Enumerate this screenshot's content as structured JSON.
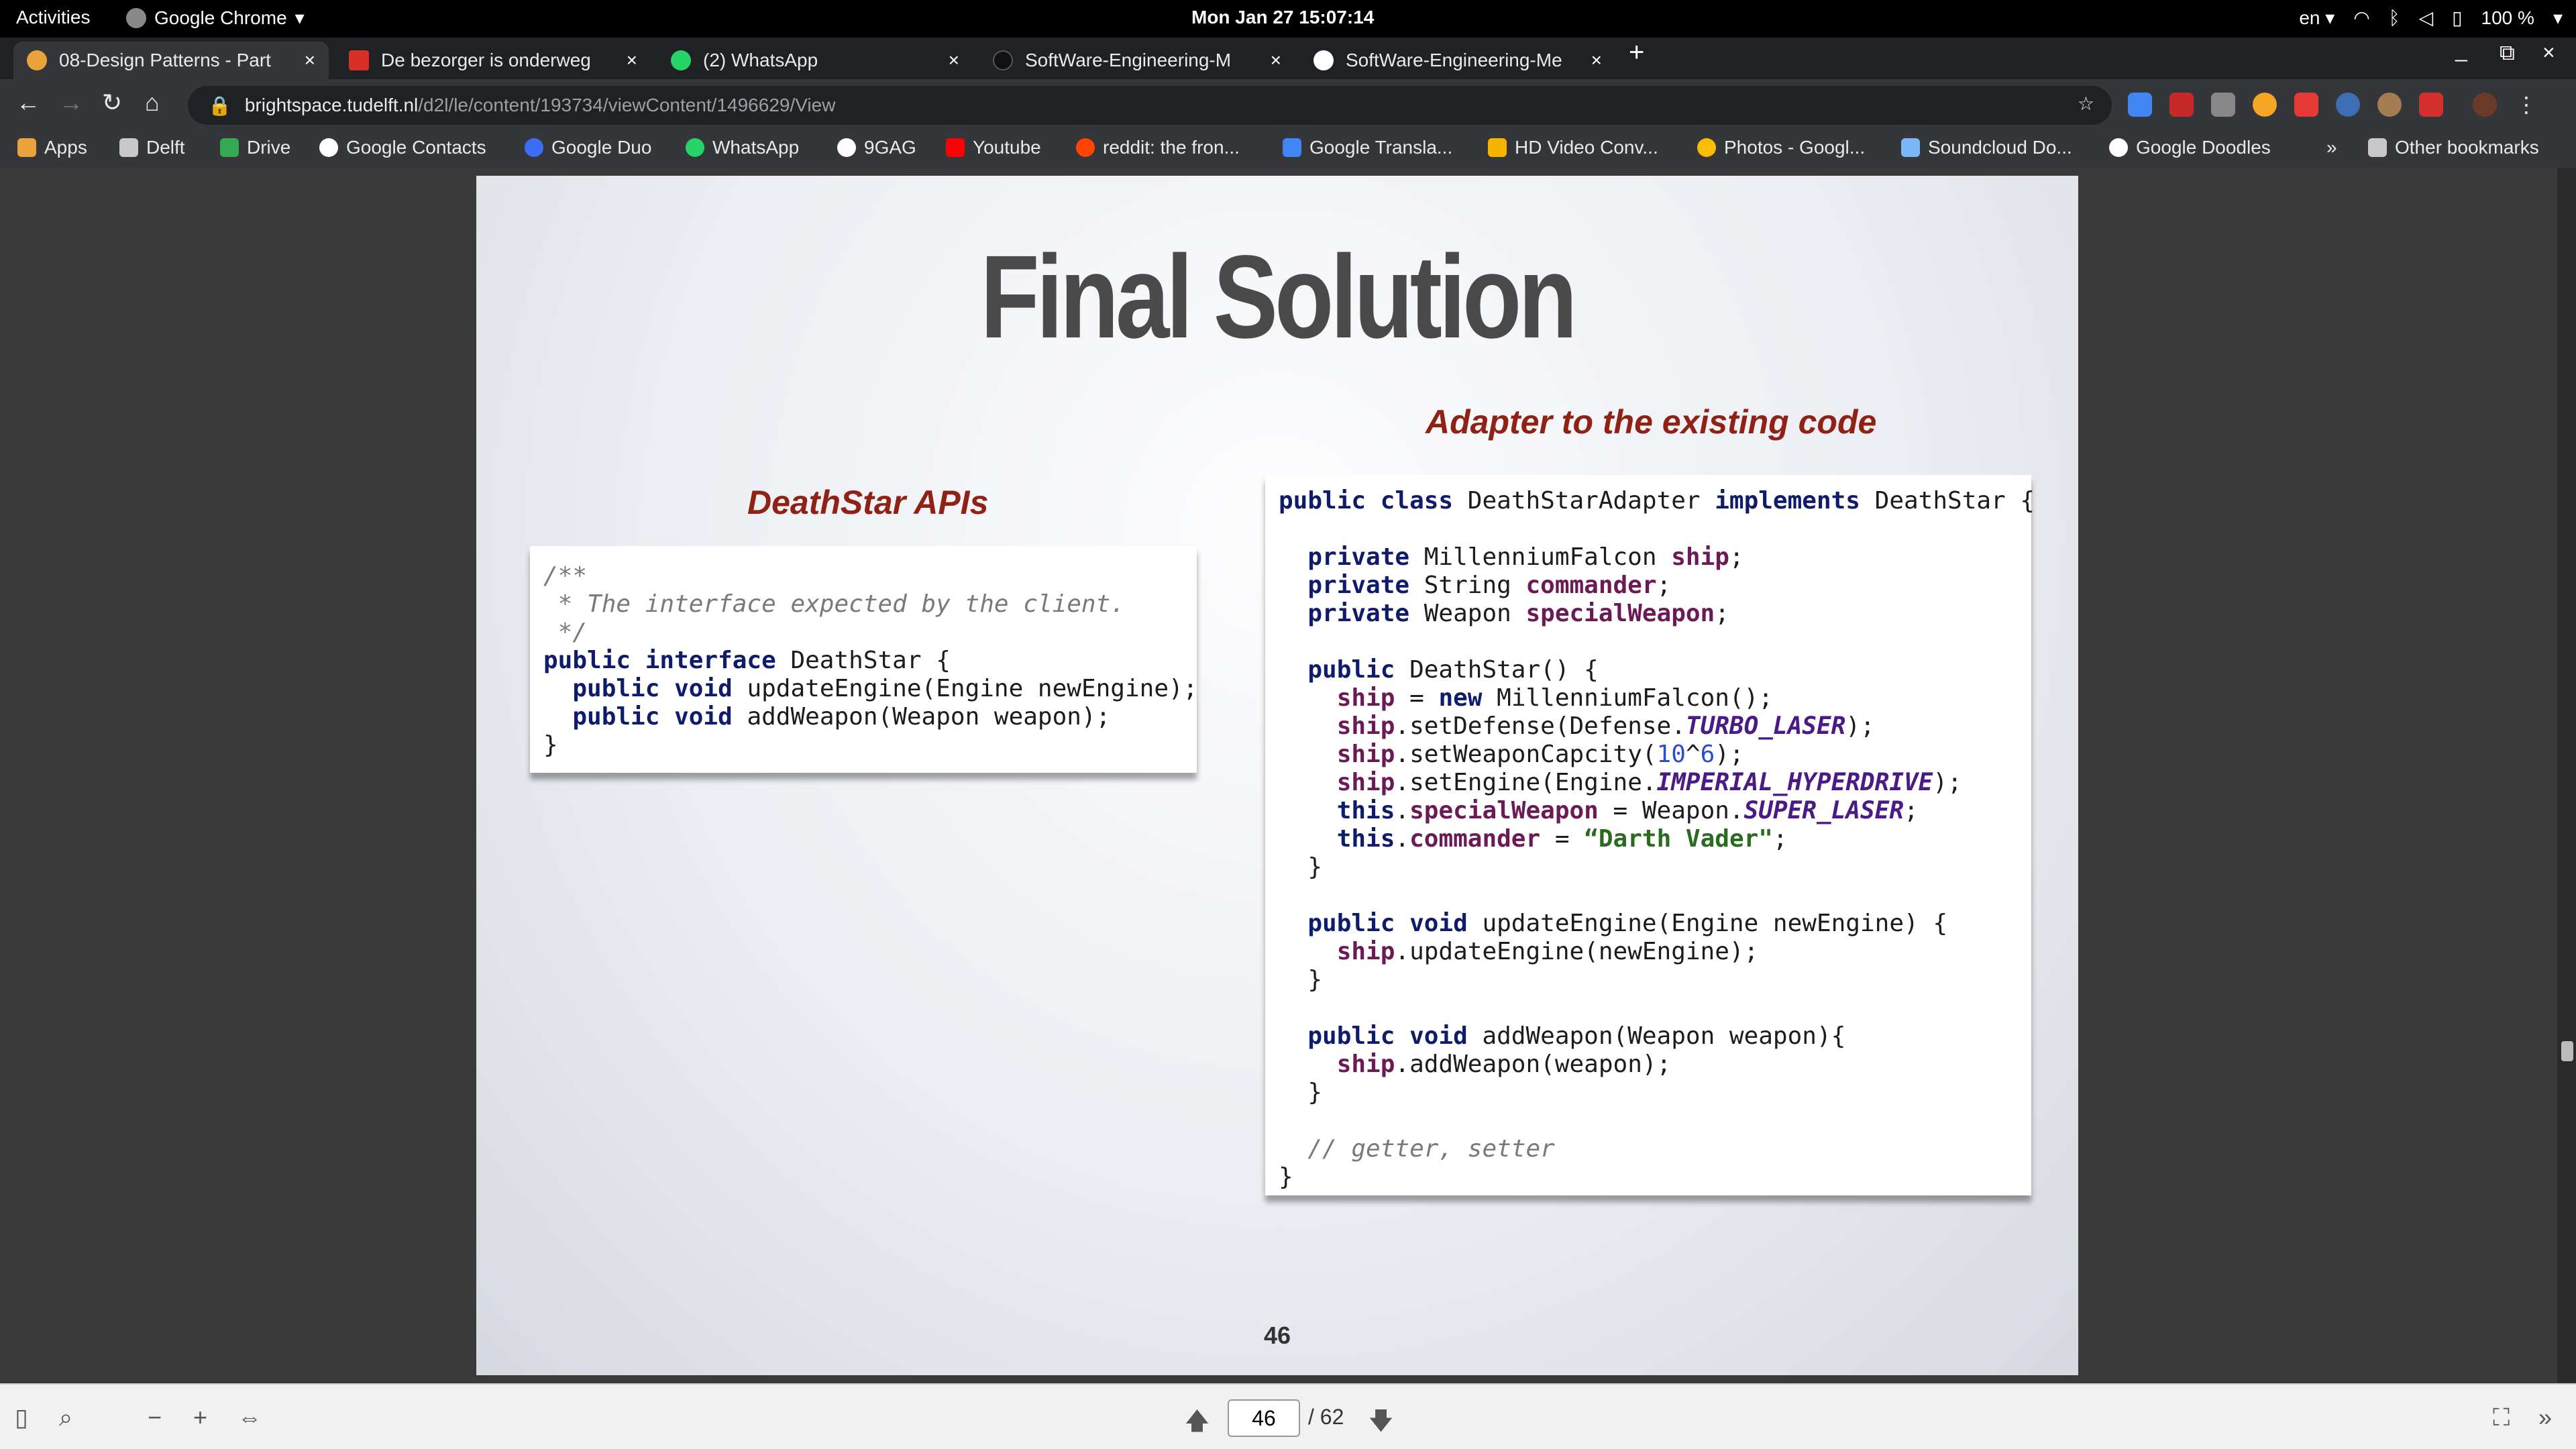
{
  "system_bar": {
    "activities": "Activities",
    "app_name": "Google Chrome",
    "clock": "Mon Jan 27  15:07:14",
    "lang": "en",
    "battery": "100 %"
  },
  "tabs": [
    {
      "title": "08-Design Patterns - Part",
      "active": true
    },
    {
      "title": "De bezorger is onderweg",
      "active": false
    },
    {
      "title": "(2) WhatsApp",
      "active": false
    },
    {
      "title": "SoftWare-Engineering-M",
      "active": false
    },
    {
      "title": "SoftWare-Engineering-Me",
      "active": false
    }
  ],
  "new_tab": "+",
  "address_bar": {
    "host": "brightspace.tudelft.nl",
    "path": "/d2l/le/content/193734/viewContent/1496629/View"
  },
  "bookmarks": [
    {
      "label": "Apps",
      "icon": "apps-grid-icon",
      "color": "#e8a33d"
    },
    {
      "label": "Delft",
      "icon": "folder-icon",
      "color": "#c8c8c8"
    },
    {
      "label": "Drive",
      "icon": "drive-icon",
      "color": "#34a853"
    },
    {
      "label": "Google Contacts",
      "icon": "globe-icon",
      "color": "#ffffff"
    },
    {
      "label": "Google Duo",
      "icon": "duo-icon",
      "color": "#3b6ef5"
    },
    {
      "label": "WhatsApp",
      "icon": "whatsapp-icon",
      "color": "#25d366"
    },
    {
      "label": "9GAG",
      "icon": "globe-icon",
      "color": "#ffffff"
    },
    {
      "label": "Youtube",
      "icon": "youtube-icon",
      "color": "#ff0000"
    },
    {
      "label": "reddit: the fron...",
      "icon": "reddit-icon",
      "color": "#ff4500"
    },
    {
      "label": "Google Transla...",
      "icon": "translate-icon",
      "color": "#4285f4"
    },
    {
      "label": "HD Video Conv...",
      "icon": "video-icon",
      "color": "#f5b400"
    },
    {
      "label": "Photos - Googl...",
      "icon": "photos-icon",
      "color": "#fbbc05"
    },
    {
      "label": "Soundcloud Do...",
      "icon": "cloud-icon",
      "color": "#7ab8f5"
    },
    {
      "label": "Google Doodles",
      "icon": "google-icon",
      "color": "#ffffff"
    }
  ],
  "bookmarks_overflow": "»",
  "other_bookmarks": "Other bookmarks",
  "slide": {
    "title": "Final Solution",
    "left_heading": "DeathStar APIs",
    "right_heading": "Adapter to the existing code",
    "page_number": "46"
  },
  "pdf_toolbar": {
    "current_page": "46",
    "total_pages": "/ 62"
  }
}
